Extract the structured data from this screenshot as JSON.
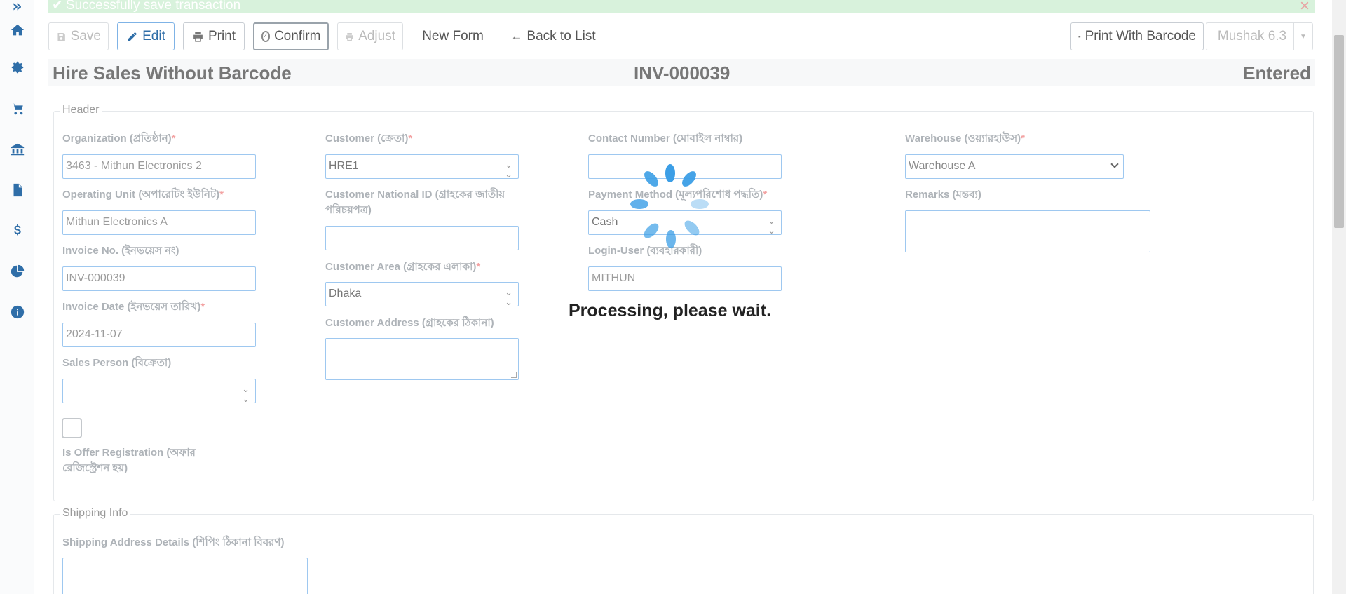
{
  "alert": {
    "message": "Successfully save transaction",
    "close": "×"
  },
  "sidebar": {
    "toggle": "»",
    "items": [
      {
        "icon": "home-icon"
      },
      {
        "icon": "gear-icon"
      },
      {
        "icon": "cart-icon"
      },
      {
        "icon": "bank-icon"
      },
      {
        "icon": "document-icon"
      },
      {
        "icon": "dollar-icon"
      },
      {
        "icon": "pie-chart-icon"
      },
      {
        "icon": "info-icon"
      }
    ]
  },
  "toolbar": {
    "save": "Save",
    "edit": "Edit",
    "print": "Print",
    "confirm": "Confirm",
    "adjust": "Adjust",
    "new_form": "New Form",
    "back_to_list": "Back to List",
    "print_with_barcode": "Print With Barcode",
    "mushak": "Mushak 6.3"
  },
  "title": {
    "form_name": "Hire Sales Without Barcode",
    "invoice": "INV-000039",
    "status": "Entered"
  },
  "header_section": {
    "legend": "Header",
    "organization": {
      "label": "Organization (প্রতিষ্ঠান)",
      "value": "3463 - Mithun Electronics 2"
    },
    "operating_unit": {
      "label": "Operating Unit (অপারেটিং ইউনিট)",
      "value": "Mithun Electronics A"
    },
    "invoice_no": {
      "label": "Invoice No. (ইনভয়েস নং)",
      "value": "INV-000039"
    },
    "invoice_date": {
      "label": "Invoice Date (ইনভয়েস তারিখ)",
      "value": "2024-11-07"
    },
    "sales_person": {
      "label": "Sales Person (বিক্রেতা)",
      "value": ""
    },
    "is_offer": {
      "label_line1": "Is Offer Registration (অফার",
      "label_line2": "রেজিস্ট্রেশন হয়)"
    },
    "customer": {
      "label": "Customer (ক্রেতা)",
      "value": "HRE1"
    },
    "customer_nid": {
      "label_line1": "Customer National ID (গ্রাহকের জাতীয়",
      "label_line2": "পরিচয়পত্র)",
      "value": ""
    },
    "customer_area": {
      "label": "Customer Area (গ্রাহকের এলাকা)",
      "value": "Dhaka"
    },
    "customer_address": {
      "label": "Customer Address (গ্রাহকের ঠিকানা)",
      "value": ""
    },
    "contact_number": {
      "label": "Contact Number (মোবাইল নাম্বার)",
      "value": ""
    },
    "payment_method": {
      "label": "Payment Method (মূল্যপরিশোধ পদ্ধতি)",
      "value": "Cash"
    },
    "login_user": {
      "label": "Login-User (ব্যবহারকারী)",
      "value": "MITHUN"
    },
    "warehouse": {
      "label": "Warehouse (ওয়্যারহাউস)",
      "value": "Warehouse A"
    },
    "remarks": {
      "label": "Remarks (মন্তব্য)",
      "value": ""
    }
  },
  "shipping_section": {
    "legend": "Shipping Info",
    "address_details": {
      "label": "Shipping Address Details (শিপিং ঠিকানা বিবরণ)",
      "value": ""
    }
  },
  "loader": {
    "text": "Processing, please wait.",
    "color": "#3b9ee6"
  }
}
